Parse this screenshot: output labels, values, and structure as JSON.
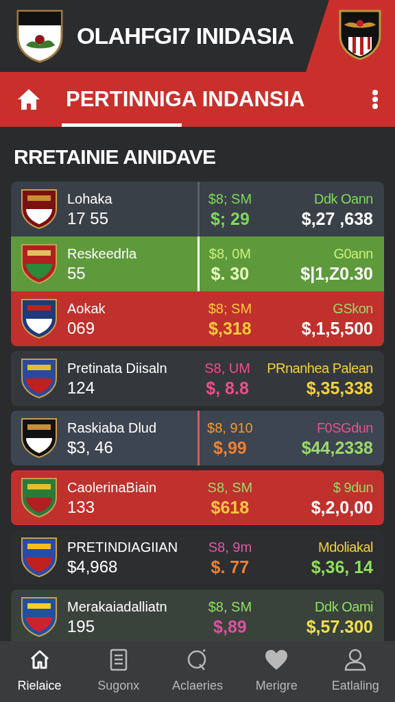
{
  "header": {
    "title": "OLAHFGI7 INIDASIA"
  },
  "navbar": {
    "title": "PERTINNIGA INDANSIA"
  },
  "section_title": "RRETAINIE AINIDAVE",
  "cards": [
    {
      "rows": [
        {
          "color": "#3a4048",
          "divider": {
            "color": "#5a606a"
          },
          "name": "Lohaka",
          "value": "17 55",
          "mid_label": {
            "text": "$8; SM",
            "color": "#7ed957"
          },
          "mid_value": {
            "text": "$; 29",
            "color": "#7ed957"
          },
          "right_label": {
            "text": "Ddk Oann",
            "color": "#7ed957"
          },
          "right_value": {
            "text": "$,27 ,638",
            "color": "#ffffff"
          }
        },
        {
          "color": "#5e9a3c",
          "divider": {
            "color": "#ffffff"
          },
          "name": "Reskeedrla",
          "value": "55",
          "mid_label": {
            "text": "$8, 0M",
            "color": "#c8f07a"
          },
          "mid_value": {
            "text": "$. 30",
            "color": "#e8ffc0"
          },
          "right_label": {
            "text": "G0ann",
            "color": "#c8f07a"
          },
          "right_value": {
            "text": "$|1,Z0.30",
            "color": "#ffffff"
          }
        },
        {
          "color": "#c0302c",
          "name": "Aokak",
          "value": "069",
          "mid_label": {
            "text": "$8; SM",
            "color": "#ffc93c"
          },
          "mid_value": {
            "text": "$,318",
            "color": "#ffc93c"
          },
          "right_label": {
            "text": "GSkon",
            "color": "#9bd86a"
          },
          "right_value": {
            "text": "$,1,5,500",
            "color": "#ffffff"
          }
        }
      ]
    },
    {
      "rows": [
        {
          "color": "#34383c",
          "name": "Pretinata Diisaln",
          "value": "124",
          "mid_label": {
            "text": "S8, UM",
            "color": "#ec4f8a"
          },
          "mid_value": {
            "text": "$, 8.8",
            "color": "#ec4f8a"
          },
          "right_label": {
            "text": "PRnanhea Palean",
            "color": "#f2d13a"
          },
          "right_value": {
            "text": "$,35,338",
            "color": "#f2d13a"
          }
        }
      ]
    },
    {
      "rows": [
        {
          "color": "#3d4550",
          "divider": {
            "color": "#e05a5a"
          },
          "name": "Raskiaba Dlud",
          "value": "$3, 46",
          "mid_label": {
            "text": "$8, 910",
            "color": "#f59a2c"
          },
          "mid_value": {
            "text": "$,99",
            "color": "#f08030"
          },
          "right_label": {
            "text": "F0SGdun",
            "color": "#ec4f8a"
          },
          "right_value": {
            "text": "$44,2338",
            "color": "#9bd86a"
          }
        }
      ]
    },
    {
      "rows": [
        {
          "color": "#c0302c",
          "name": "CaolerinaBiain",
          "value": "133",
          "mid_label": {
            "text": "S8, SM",
            "color": "#9bd86a"
          },
          "mid_value": {
            "text": "$618",
            "color": "#ffc93c"
          },
          "right_label": {
            "text": "$ 9dun",
            "color": "#9bd86a"
          },
          "right_value": {
            "text": "$,2,0,00",
            "color": "#ffffff"
          }
        }
      ]
    },
    {
      "rows": [
        {
          "color": "#2c2e30",
          "name": "PRETINDIAGIIAN",
          "value": "$4,968",
          "mid_label": {
            "text": "S8, 9m",
            "color": "#e05aa8"
          },
          "mid_value": {
            "text": "$. 77",
            "color": "#f08030"
          },
          "right_label": {
            "text": "Mdoliakal",
            "color": "#f2d13a"
          },
          "right_value": {
            "text": "$,36, 14",
            "color": "#8ee05a"
          }
        }
      ]
    },
    {
      "rows": [
        {
          "color": "#3a423c",
          "name": "Merakaiadalliatn",
          "value": "195",
          "mid_label": {
            "text": "$8, SM",
            "color": "#8ee05a"
          },
          "mid_value": {
            "text": "$,89",
            "color": "#e050a0"
          },
          "right_label": {
            "text": "Ddk Oami",
            "color": "#8ee05a"
          },
          "right_value": {
            "text": "$,57.300",
            "color": "#f2e04a"
          }
        }
      ]
    }
  ],
  "bottom_nav": [
    {
      "kind": "home",
      "label": "Rielaice",
      "selected": true
    },
    {
      "kind": "list",
      "label": "Sugonx",
      "selected": false
    },
    {
      "kind": "search",
      "label": "Aclaeries",
      "selected": false
    },
    {
      "kind": "heart",
      "label": "Merigre",
      "selected": false
    },
    {
      "kind": "person",
      "label": "Eatlaling",
      "selected": false
    }
  ]
}
